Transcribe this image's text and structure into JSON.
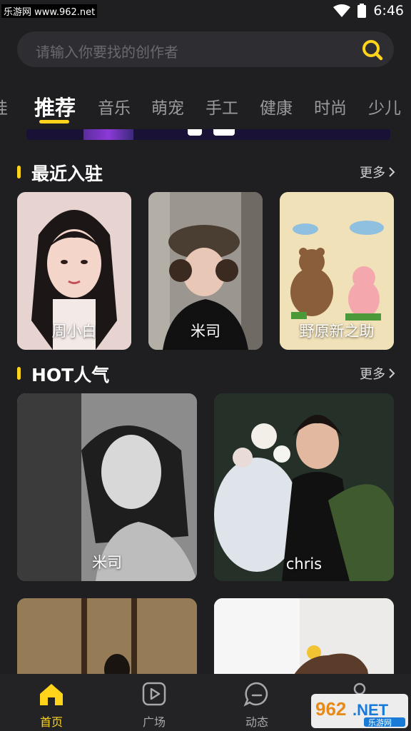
{
  "status": {
    "watermark": "乐游网 www.962.net",
    "time": "6:46"
  },
  "search": {
    "placeholder": "请输入你要找的创作者"
  },
  "tabs": [
    {
      "label": "娃"
    },
    {
      "label": "推荐"
    },
    {
      "label": "音乐"
    },
    {
      "label": "萌宠"
    },
    {
      "label": "手工"
    },
    {
      "label": "健康"
    },
    {
      "label": "时尚"
    },
    {
      "label": "少儿"
    }
  ],
  "sections": {
    "recent": {
      "title": "最近入驻",
      "more": "更多",
      "cards": [
        {
          "name": "周小白"
        },
        {
          "name": "米司"
        },
        {
          "name": "野原新之助"
        }
      ]
    },
    "hot": {
      "title": "HOT人气",
      "more": "更多",
      "cards": [
        {
          "name": "米司"
        },
        {
          "name": "chris"
        },
        {
          "name": ""
        },
        {
          "name": ""
        }
      ]
    }
  },
  "tabbar": [
    {
      "label": "首页",
      "icon": "home-icon"
    },
    {
      "label": "广场",
      "icon": "play-square-icon"
    },
    {
      "label": "动态",
      "icon": "chat-bubble-icon"
    },
    {
      "label": "",
      "icon": "profile-icon"
    }
  ],
  "watermark_bottom": {
    "logo": "962.NET",
    "sub": "乐游网"
  },
  "colors": {
    "accent": "#ffd41a",
    "background": "#1f1f22",
    "search_bg": "#2e2e32"
  }
}
